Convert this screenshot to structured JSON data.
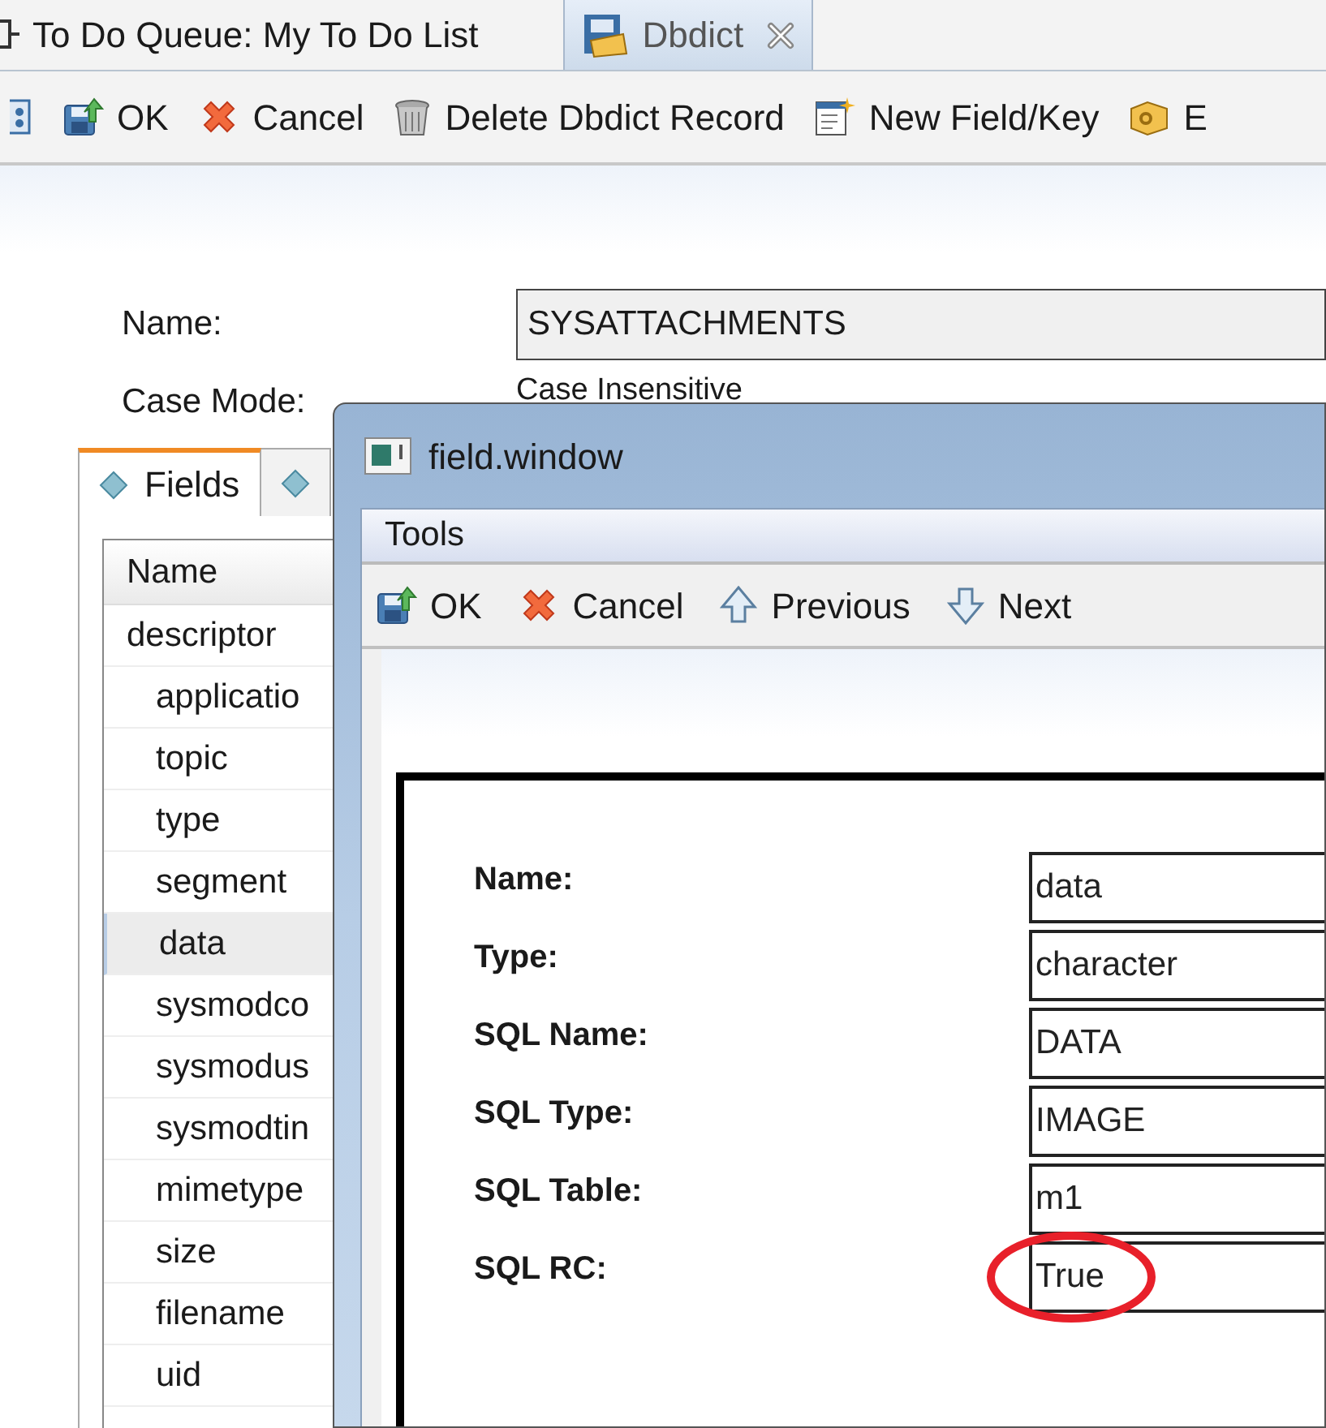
{
  "editor_tabs": [
    {
      "label": "To Do Queue: My To Do List",
      "selected": false,
      "closable": false
    },
    {
      "label": "Dbdict",
      "selected": true,
      "closable": true
    }
  ],
  "toolbar": [
    {
      "kind": "view"
    },
    {
      "kind": "ok",
      "label": "OK"
    },
    {
      "kind": "cancel",
      "label": "Cancel"
    },
    {
      "kind": "delete",
      "label": "Delete Dbdict Record"
    },
    {
      "kind": "new",
      "label": "New Field/Key"
    },
    {
      "kind": "key",
      "label": "E"
    }
  ],
  "form": [
    {
      "kind": "field",
      "label": "Name:",
      "value": "SYSATTACHMENTS"
    },
    {
      "kind": "text",
      "label": "Case Mode:",
      "value": "Case Insensitive"
    }
  ],
  "folder_tabs": [
    {
      "label": "Fields",
      "selected": true
    },
    {
      "selected": false
    }
  ],
  "fields_table": {
    "columns": [
      "Name"
    ],
    "rows": [
      {
        "name": "descriptor",
        "selected": false,
        "children": [
          {
            "name": "applicatio",
            "selected": false
          },
          {
            "name": "topic",
            "selected": false
          },
          {
            "name": "type",
            "selected": false
          },
          {
            "name": "segment",
            "selected": false
          },
          {
            "name": "data",
            "selected": true
          },
          {
            "name": "sysmodco",
            "selected": false
          },
          {
            "name": "sysmodus",
            "selected": false
          },
          {
            "name": "sysmodtin",
            "selected": false
          },
          {
            "name": "mimetype",
            "selected": false
          },
          {
            "name": "size",
            "selected": false
          },
          {
            "name": "filename",
            "selected": false
          },
          {
            "name": "uid",
            "selected": false
          }
        ]
      }
    ]
  },
  "dialog": {
    "title": "field.window",
    "menu": [
      "Tools"
    ],
    "toolbar": [
      {
        "kind": "ok",
        "label": "OK"
      },
      {
        "kind": "cancel",
        "label": "Cancel"
      },
      {
        "kind": "previous",
        "label": "Previous"
      },
      {
        "kind": "next",
        "label": "Next"
      }
    ],
    "fields": [
      {
        "label": "Name:",
        "value": "data",
        "annotated": false
      },
      {
        "label": "Type:",
        "value": "character",
        "annotated": false
      },
      {
        "label": "SQL Name:",
        "value": "DATA",
        "annotated": false
      },
      {
        "label": "SQL Type:",
        "value": "IMAGE",
        "annotated": false
      },
      {
        "label": "SQL Table:",
        "value": "m1",
        "annotated": false
      },
      {
        "label": "SQL RC:",
        "value": "True",
        "annotated": true
      }
    ]
  }
}
